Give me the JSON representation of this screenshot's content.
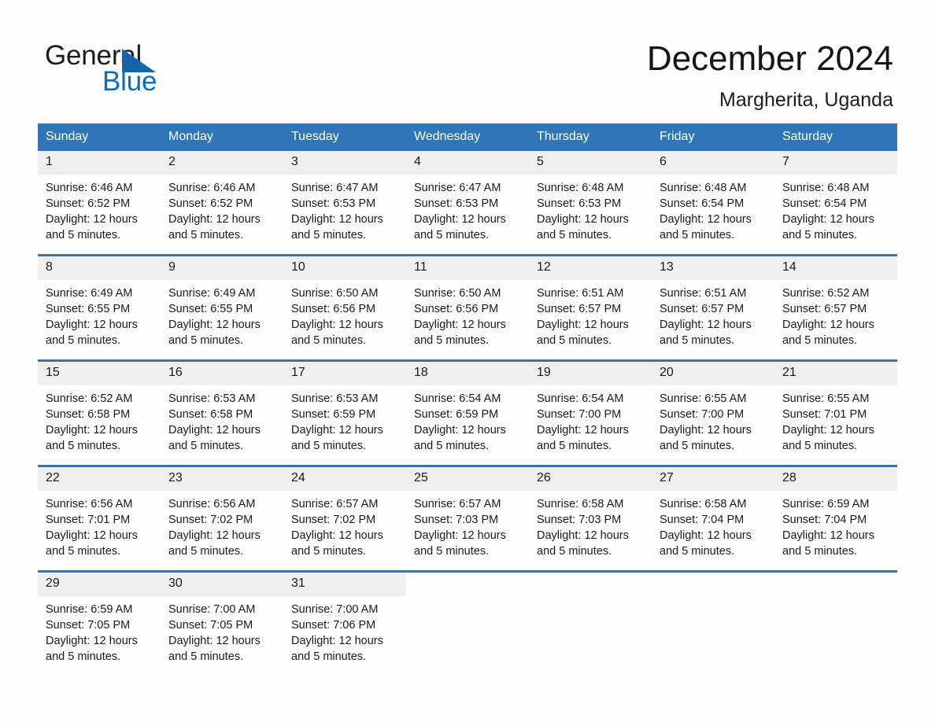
{
  "brand": {
    "name_part1": "General",
    "name_part2": "Blue",
    "logo_icon": "triangle-icon",
    "accent_color": "#1565ab"
  },
  "header": {
    "month_title": "December 2024",
    "location": "Margherita, Uganda"
  },
  "theme": {
    "header_blue": "#2e76b8",
    "daynum_gray": "#efefef",
    "text_dark": "#1a1a1a",
    "page_bg": "#fdfdfd"
  },
  "calendar": {
    "weekday_headers": [
      "Sunday",
      "Monday",
      "Tuesday",
      "Wednesday",
      "Thursday",
      "Friday",
      "Saturday"
    ],
    "weeks": [
      [
        {
          "day": "1",
          "sunrise": "Sunrise: 6:46 AM",
          "sunset": "Sunset: 6:52 PM",
          "daylight_line1": "Daylight: 12 hours",
          "daylight_line2": "and 5 minutes."
        },
        {
          "day": "2",
          "sunrise": "Sunrise: 6:46 AM",
          "sunset": "Sunset: 6:52 PM",
          "daylight_line1": "Daylight: 12 hours",
          "daylight_line2": "and 5 minutes."
        },
        {
          "day": "3",
          "sunrise": "Sunrise: 6:47 AM",
          "sunset": "Sunset: 6:53 PM",
          "daylight_line1": "Daylight: 12 hours",
          "daylight_line2": "and 5 minutes."
        },
        {
          "day": "4",
          "sunrise": "Sunrise: 6:47 AM",
          "sunset": "Sunset: 6:53 PM",
          "daylight_line1": "Daylight: 12 hours",
          "daylight_line2": "and 5 minutes."
        },
        {
          "day": "5",
          "sunrise": "Sunrise: 6:48 AM",
          "sunset": "Sunset: 6:53 PM",
          "daylight_line1": "Daylight: 12 hours",
          "daylight_line2": "and 5 minutes."
        },
        {
          "day": "6",
          "sunrise": "Sunrise: 6:48 AM",
          "sunset": "Sunset: 6:54 PM",
          "daylight_line1": "Daylight: 12 hours",
          "daylight_line2": "and 5 minutes."
        },
        {
          "day": "7",
          "sunrise": "Sunrise: 6:48 AM",
          "sunset": "Sunset: 6:54 PM",
          "daylight_line1": "Daylight: 12 hours",
          "daylight_line2": "and 5 minutes."
        }
      ],
      [
        {
          "day": "8",
          "sunrise": "Sunrise: 6:49 AM",
          "sunset": "Sunset: 6:55 PM",
          "daylight_line1": "Daylight: 12 hours",
          "daylight_line2": "and 5 minutes."
        },
        {
          "day": "9",
          "sunrise": "Sunrise: 6:49 AM",
          "sunset": "Sunset: 6:55 PM",
          "daylight_line1": "Daylight: 12 hours",
          "daylight_line2": "and 5 minutes."
        },
        {
          "day": "10",
          "sunrise": "Sunrise: 6:50 AM",
          "sunset": "Sunset: 6:56 PM",
          "daylight_line1": "Daylight: 12 hours",
          "daylight_line2": "and 5 minutes."
        },
        {
          "day": "11",
          "sunrise": "Sunrise: 6:50 AM",
          "sunset": "Sunset: 6:56 PM",
          "daylight_line1": "Daylight: 12 hours",
          "daylight_line2": "and 5 minutes."
        },
        {
          "day": "12",
          "sunrise": "Sunrise: 6:51 AM",
          "sunset": "Sunset: 6:57 PM",
          "daylight_line1": "Daylight: 12 hours",
          "daylight_line2": "and 5 minutes."
        },
        {
          "day": "13",
          "sunrise": "Sunrise: 6:51 AM",
          "sunset": "Sunset: 6:57 PM",
          "daylight_line1": "Daylight: 12 hours",
          "daylight_line2": "and 5 minutes."
        },
        {
          "day": "14",
          "sunrise": "Sunrise: 6:52 AM",
          "sunset": "Sunset: 6:57 PM",
          "daylight_line1": "Daylight: 12 hours",
          "daylight_line2": "and 5 minutes."
        }
      ],
      [
        {
          "day": "15",
          "sunrise": "Sunrise: 6:52 AM",
          "sunset": "Sunset: 6:58 PM",
          "daylight_line1": "Daylight: 12 hours",
          "daylight_line2": "and 5 minutes."
        },
        {
          "day": "16",
          "sunrise": "Sunrise: 6:53 AM",
          "sunset": "Sunset: 6:58 PM",
          "daylight_line1": "Daylight: 12 hours",
          "daylight_line2": "and 5 minutes."
        },
        {
          "day": "17",
          "sunrise": "Sunrise: 6:53 AM",
          "sunset": "Sunset: 6:59 PM",
          "daylight_line1": "Daylight: 12 hours",
          "daylight_line2": "and 5 minutes."
        },
        {
          "day": "18",
          "sunrise": "Sunrise: 6:54 AM",
          "sunset": "Sunset: 6:59 PM",
          "daylight_line1": "Daylight: 12 hours",
          "daylight_line2": "and 5 minutes."
        },
        {
          "day": "19",
          "sunrise": "Sunrise: 6:54 AM",
          "sunset": "Sunset: 7:00 PM",
          "daylight_line1": "Daylight: 12 hours",
          "daylight_line2": "and 5 minutes."
        },
        {
          "day": "20",
          "sunrise": "Sunrise: 6:55 AM",
          "sunset": "Sunset: 7:00 PM",
          "daylight_line1": "Daylight: 12 hours",
          "daylight_line2": "and 5 minutes."
        },
        {
          "day": "21",
          "sunrise": "Sunrise: 6:55 AM",
          "sunset": "Sunset: 7:01 PM",
          "daylight_line1": "Daylight: 12 hours",
          "daylight_line2": "and 5 minutes."
        }
      ],
      [
        {
          "day": "22",
          "sunrise": "Sunrise: 6:56 AM",
          "sunset": "Sunset: 7:01 PM",
          "daylight_line1": "Daylight: 12 hours",
          "daylight_line2": "and 5 minutes."
        },
        {
          "day": "23",
          "sunrise": "Sunrise: 6:56 AM",
          "sunset": "Sunset: 7:02 PM",
          "daylight_line1": "Daylight: 12 hours",
          "daylight_line2": "and 5 minutes."
        },
        {
          "day": "24",
          "sunrise": "Sunrise: 6:57 AM",
          "sunset": "Sunset: 7:02 PM",
          "daylight_line1": "Daylight: 12 hours",
          "daylight_line2": "and 5 minutes."
        },
        {
          "day": "25",
          "sunrise": "Sunrise: 6:57 AM",
          "sunset": "Sunset: 7:03 PM",
          "daylight_line1": "Daylight: 12 hours",
          "daylight_line2": "and 5 minutes."
        },
        {
          "day": "26",
          "sunrise": "Sunrise: 6:58 AM",
          "sunset": "Sunset: 7:03 PM",
          "daylight_line1": "Daylight: 12 hours",
          "daylight_line2": "and 5 minutes."
        },
        {
          "day": "27",
          "sunrise": "Sunrise: 6:58 AM",
          "sunset": "Sunset: 7:04 PM",
          "daylight_line1": "Daylight: 12 hours",
          "daylight_line2": "and 5 minutes."
        },
        {
          "day": "28",
          "sunrise": "Sunrise: 6:59 AM",
          "sunset": "Sunset: 7:04 PM",
          "daylight_line1": "Daylight: 12 hours",
          "daylight_line2": "and 5 minutes."
        }
      ],
      [
        {
          "day": "29",
          "sunrise": "Sunrise: 6:59 AM",
          "sunset": "Sunset: 7:05 PM",
          "daylight_line1": "Daylight: 12 hours",
          "daylight_line2": "and 5 minutes."
        },
        {
          "day": "30",
          "sunrise": "Sunrise: 7:00 AM",
          "sunset": "Sunset: 7:05 PM",
          "daylight_line1": "Daylight: 12 hours",
          "daylight_line2": "and 5 minutes."
        },
        {
          "day": "31",
          "sunrise": "Sunrise: 7:00 AM",
          "sunset": "Sunset: 7:06 PM",
          "daylight_line1": "Daylight: 12 hours",
          "daylight_line2": "and 5 minutes."
        },
        {
          "day": "",
          "sunrise": "",
          "sunset": "",
          "daylight_line1": "",
          "daylight_line2": ""
        },
        {
          "day": "",
          "sunrise": "",
          "sunset": "",
          "daylight_line1": "",
          "daylight_line2": ""
        },
        {
          "day": "",
          "sunrise": "",
          "sunset": "",
          "daylight_line1": "",
          "daylight_line2": ""
        },
        {
          "day": "",
          "sunrise": "",
          "sunset": "",
          "daylight_line1": "",
          "daylight_line2": ""
        }
      ]
    ]
  }
}
